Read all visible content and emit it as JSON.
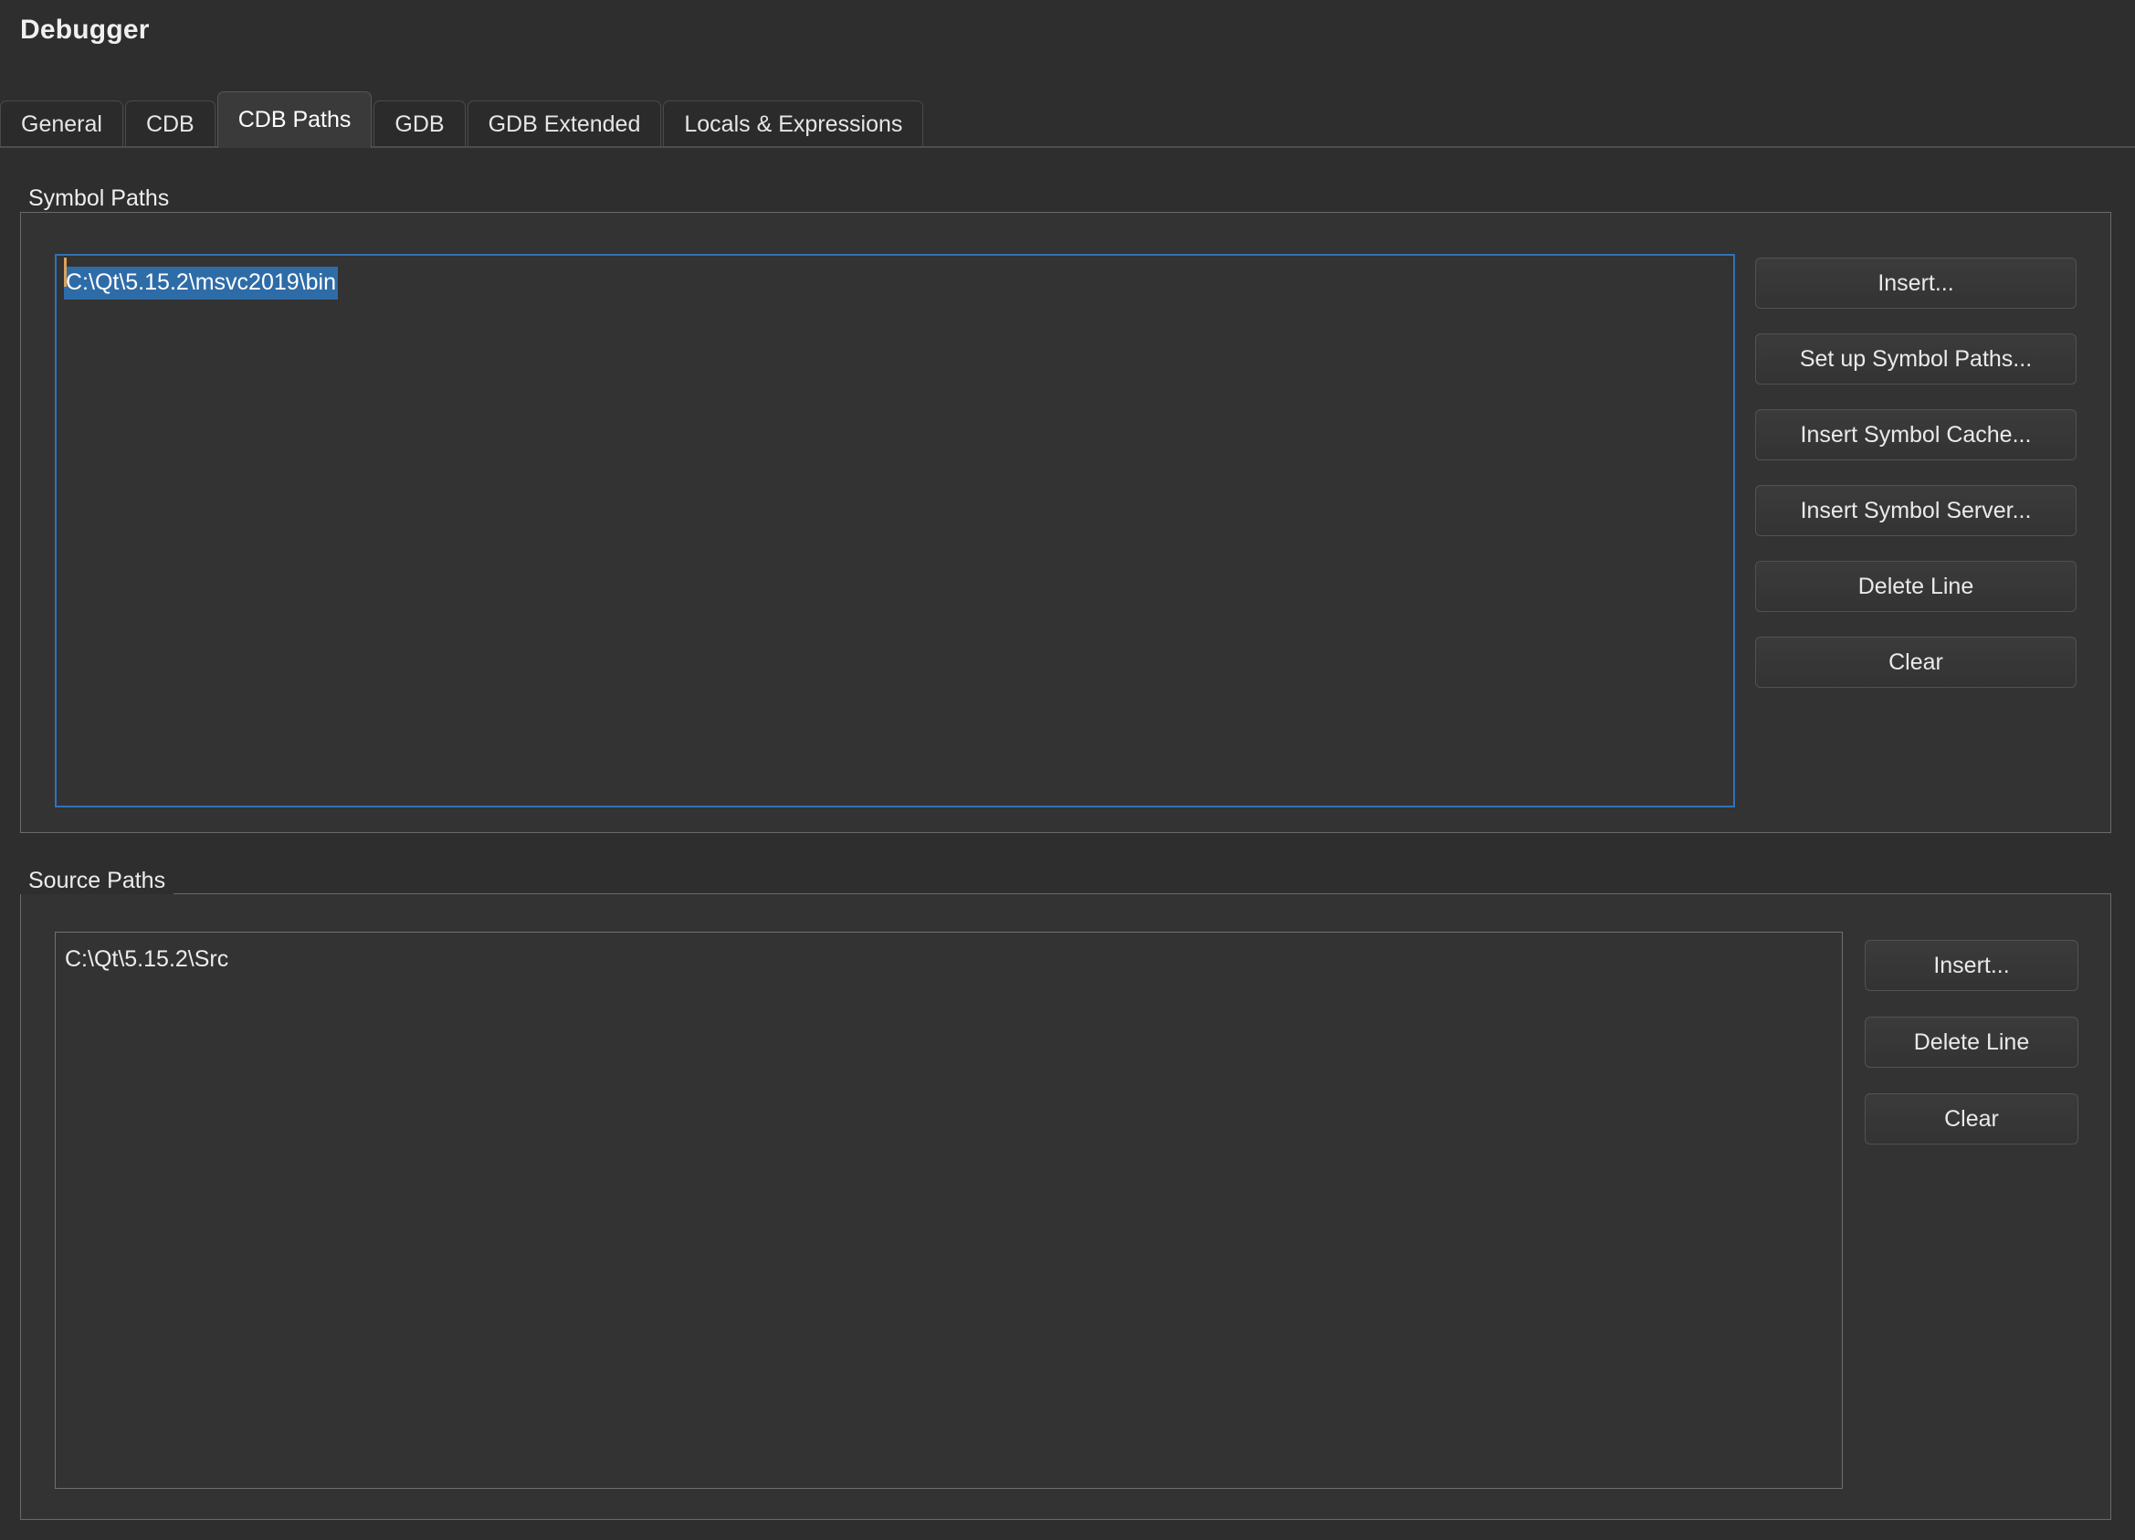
{
  "window": {
    "title": "Debugger"
  },
  "tabs": [
    {
      "label": "General",
      "active": false
    },
    {
      "label": "CDB",
      "active": false
    },
    {
      "label": "CDB Paths",
      "active": true
    },
    {
      "label": "GDB",
      "active": false
    },
    {
      "label": "GDB Extended",
      "active": false
    },
    {
      "label": "Locals & Expressions",
      "active": false
    }
  ],
  "symbol_paths": {
    "group_label": "Symbol Paths",
    "entries": [
      {
        "text": "C:\\Qt\\5.15.2\\msvc2019\\bin",
        "selected": true,
        "caret": true
      }
    ],
    "buttons": [
      {
        "label": "Insert..."
      },
      {
        "label": "Set up Symbol Paths..."
      },
      {
        "label": "Insert Symbol Cache..."
      },
      {
        "label": "Insert Symbol Server..."
      },
      {
        "label": "Delete Line"
      },
      {
        "label": "Clear"
      }
    ]
  },
  "source_paths": {
    "group_label": "Source Paths",
    "entries": [
      {
        "text": "C:\\Qt\\5.15.2\\Src",
        "selected": false,
        "caret": false
      }
    ],
    "buttons": [
      {
        "label": "Insert..."
      },
      {
        "label": "Delete Line"
      },
      {
        "label": "Clear"
      }
    ]
  },
  "colors": {
    "background": "#2e2e2e",
    "panel": "#333333",
    "selection_blue": "#2e6ca8",
    "focus_border_blue": "#2f73b8",
    "caret_orange": "#d9a35c",
    "border_gray": "#6a6a6a",
    "text": "#ececec"
  }
}
